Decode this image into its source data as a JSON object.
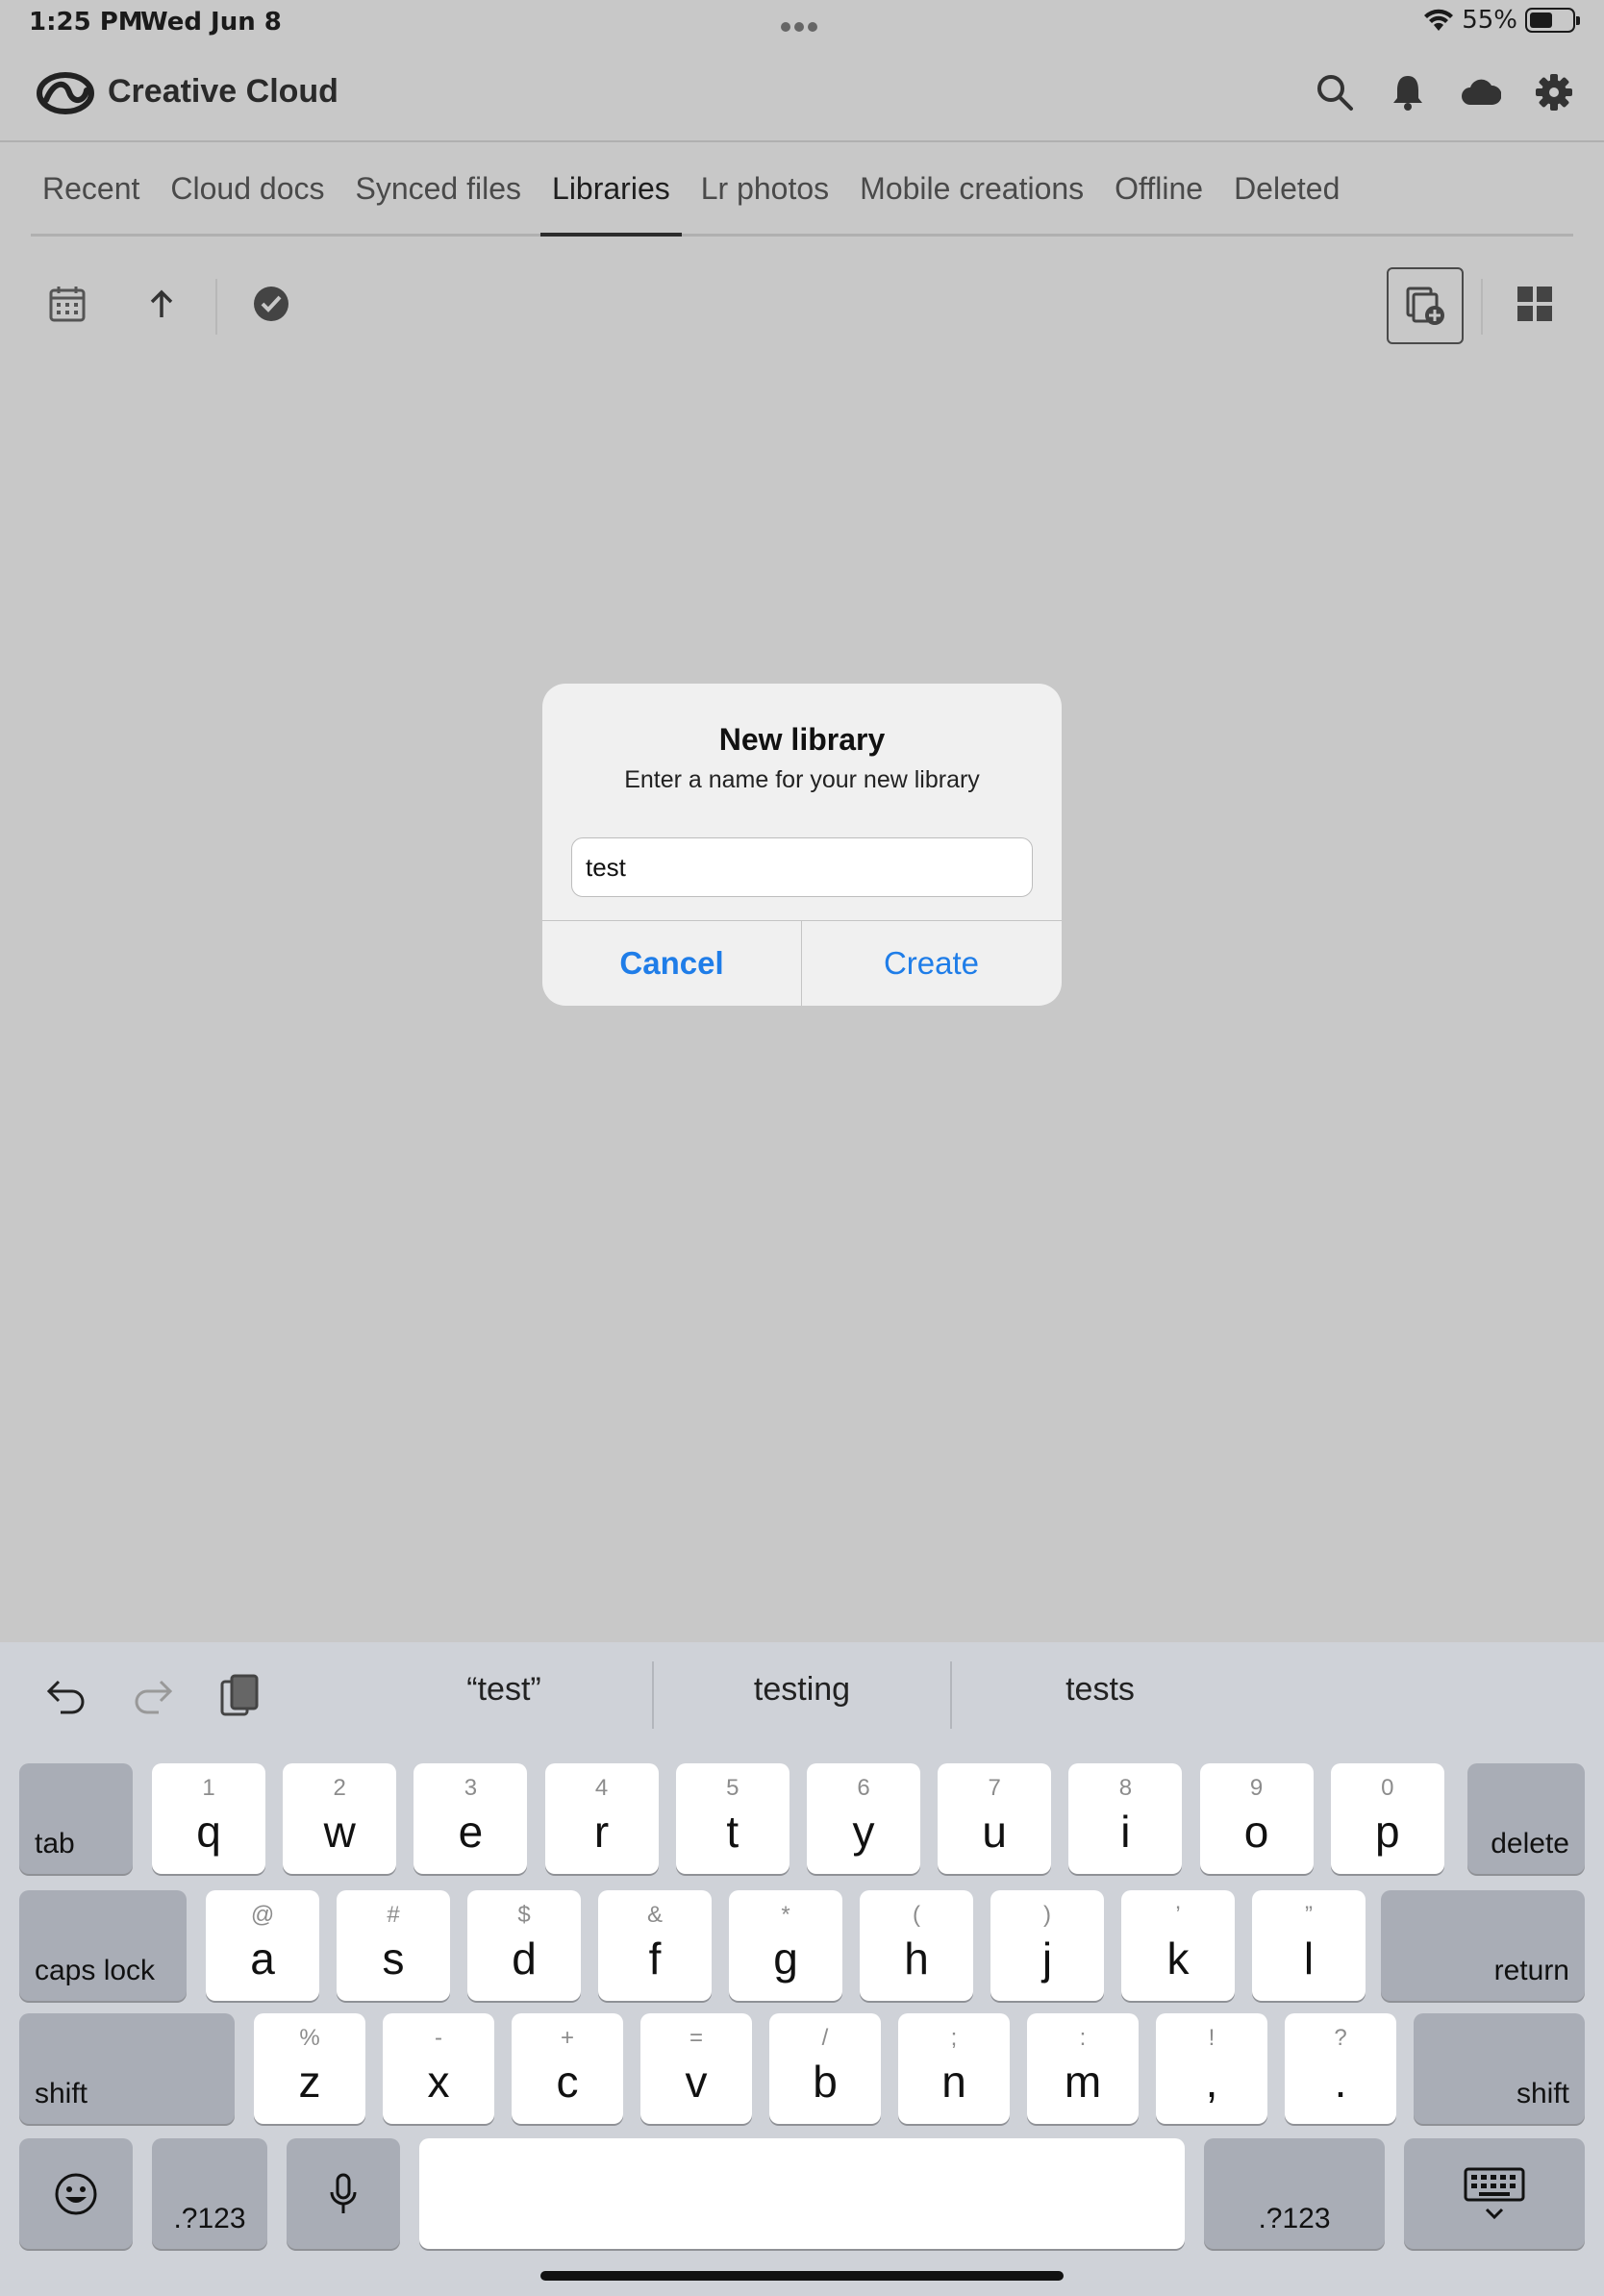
{
  "status_bar": {
    "time": "1:25 PM",
    "date": "Wed Jun 8",
    "battery_percent": "55%",
    "battery_level": 0.55
  },
  "header": {
    "app_title": "Creative Cloud"
  },
  "tabs": [
    {
      "label": "Recent"
    },
    {
      "label": "Cloud docs"
    },
    {
      "label": "Synced files"
    },
    {
      "label": "Libraries",
      "active": true
    },
    {
      "label": "Lr photos"
    },
    {
      "label": "Mobile creations"
    },
    {
      "label": "Offline"
    },
    {
      "label": "Deleted"
    }
  ],
  "dialog": {
    "title": "New library",
    "message": "Enter a name for your new library",
    "input_value": "test",
    "cancel_label": "Cancel",
    "create_label": "Create"
  },
  "keyboard": {
    "suggestions": [
      "“test”",
      "testing",
      "tests"
    ],
    "row1": [
      {
        "num": "1",
        "ltr": "q"
      },
      {
        "num": "2",
        "ltr": "w"
      },
      {
        "num": "3",
        "ltr": "e"
      },
      {
        "num": "4",
        "ltr": "r"
      },
      {
        "num": "5",
        "ltr": "t"
      },
      {
        "num": "6",
        "ltr": "y"
      },
      {
        "num": "7",
        "ltr": "u"
      },
      {
        "num": "8",
        "ltr": "i"
      },
      {
        "num": "9",
        "ltr": "o"
      },
      {
        "num": "0",
        "ltr": "p"
      }
    ],
    "row2": [
      {
        "num": "@",
        "ltr": "a"
      },
      {
        "num": "#",
        "ltr": "s"
      },
      {
        "num": "$",
        "ltr": "d"
      },
      {
        "num": "&",
        "ltr": "f"
      },
      {
        "num": "*",
        "ltr": "g"
      },
      {
        "num": "(",
        "ltr": "h"
      },
      {
        "num": ")",
        "ltr": "j"
      },
      {
        "num": "’",
        "ltr": "k"
      },
      {
        "num": "”",
        "ltr": "l"
      }
    ],
    "row3": [
      {
        "num": "%",
        "ltr": "z"
      },
      {
        "num": "-",
        "ltr": "x"
      },
      {
        "num": "+",
        "ltr": "c"
      },
      {
        "num": "=",
        "ltr": "v"
      },
      {
        "num": "/",
        "ltr": "b"
      },
      {
        "num": ";",
        "ltr": "n"
      },
      {
        "num": ":",
        "ltr": "m"
      },
      {
        "num": "!",
        "ltr": ","
      },
      {
        "num": "?",
        "ltr": "."
      }
    ],
    "tab_label": "tab",
    "delete_label": "delete",
    "caps_label": "caps lock",
    "return_label": "return",
    "shift_label": "shift",
    "numbers_label": ".?123"
  },
  "colors": {
    "accent": "#1f7de8",
    "background": "#c8c8c8",
    "keyboard_bg": "#cfd2d8"
  }
}
